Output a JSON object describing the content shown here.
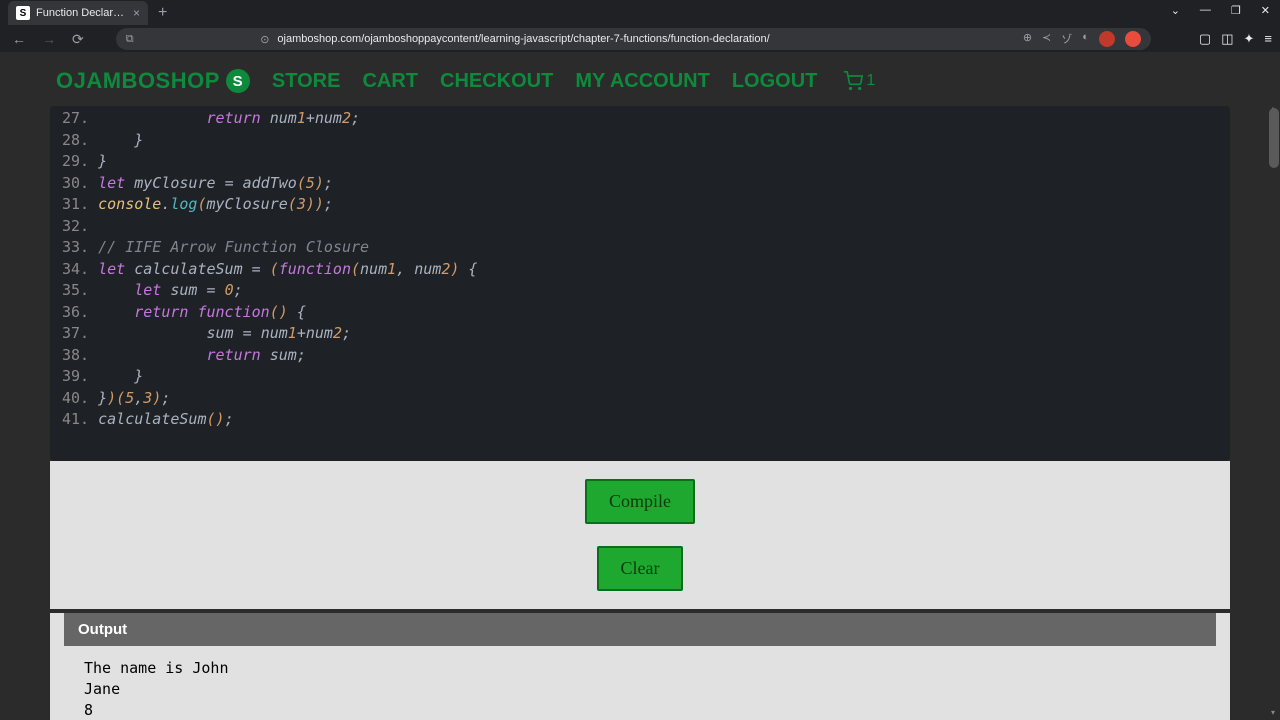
{
  "browser": {
    "tab_title": "Function Declaration - Ojam",
    "tab_favicon": "S",
    "url": "ojamboshop.com/ojamboshoppaycontent/learning-javascript/chapter-7-functions/function-declaration/"
  },
  "header": {
    "logo_text": "OJAMBOSHOP",
    "logo_badge": "S",
    "nav": [
      "STORE",
      "CART",
      "CHECKOUT",
      "MY ACCOUNT",
      "LOGOUT"
    ],
    "cart_count": "1"
  },
  "code": {
    "lines": [
      {
        "n": "27.",
        "html": "            <span class='kw'>return</span> <span class='id'>num</span><span class='num'>1</span><span class='op'>+</span><span class='id'>num</span><span class='num'>2</span>;"
      },
      {
        "n": "28.",
        "html": "    <span class='brace'>}</span>"
      },
      {
        "n": "29.",
        "html": "<span class='brace'>}</span>"
      },
      {
        "n": "30.",
        "html": "<span class='kw'>let</span> <span class='id'>myClosure</span> <span class='op'>=</span> <span class='id'>addTwo</span><span class='paren'>(</span><span class='num'>5</span><span class='paren'>)</span>;"
      },
      {
        "n": "31.",
        "html": "<span class='obj'>console</span>.<span class='fn'>log</span><span class='paren'>(</span><span class='id'>myClosure</span><span class='paren'>(</span><span class='num'>3</span><span class='paren'>))</span>;"
      },
      {
        "n": "32.",
        "html": ""
      },
      {
        "n": "33.",
        "html": "<span class='cm'>// IIFE Arrow Function Closure</span>"
      },
      {
        "n": "34.",
        "html": "<span class='kw'>let</span> <span class='id'>calculateSum</span> <span class='op'>=</span> <span class='paren'>(</span><span class='kw'>function</span><span class='paren'>(</span><span class='id'>num</span><span class='num'>1</span>, <span class='id'>num</span><span class='num'>2</span><span class='paren'>)</span> <span class='brace'>{</span>"
      },
      {
        "n": "35.",
        "html": "    <span class='kw'>let</span> <span class='id'>sum</span> <span class='op'>=</span> <span class='num'>0</span>;"
      },
      {
        "n": "36.",
        "html": "    <span class='kw'>return</span> <span class='kw'>function</span><span class='paren'>()</span> <span class='brace'>{</span>"
      },
      {
        "n": "37.",
        "html": "            <span class='id'>sum</span> <span class='op'>=</span> <span class='id'>num</span><span class='num'>1</span><span class='op'>+</span><span class='id'>num</span><span class='num'>2</span>;"
      },
      {
        "n": "38.",
        "html": "            <span class='kw'>return</span> <span class='id'>sum</span>;"
      },
      {
        "n": "39.",
        "html": "    <span class='brace'>}</span>"
      },
      {
        "n": "40.",
        "html": "<span class='brace'>}</span><span class='paren'>)(</span><span class='num'>5</span>,<span class='num'>3</span><span class='paren'>)</span>;"
      },
      {
        "n": "41.",
        "html": "<span class='id'>calculateSum</span><span class='paren'>()</span>;"
      }
    ]
  },
  "buttons": {
    "compile": "Compile",
    "clear": "Clear"
  },
  "output": {
    "header": "Output",
    "lines": [
      "The name is John",
      "Jane",
      "8"
    ]
  }
}
